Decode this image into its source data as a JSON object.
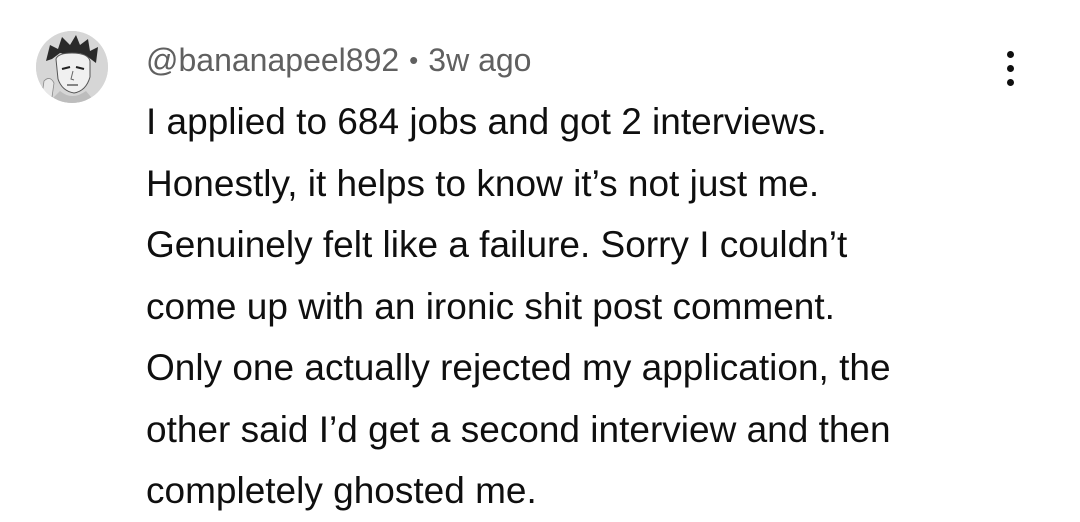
{
  "comment": {
    "author": "@bananapeel892",
    "separator": "•",
    "timestamp": "3w ago",
    "avatar_icon": "manga-portrait-avatar",
    "menu_icon": "more-vertical-icon",
    "lines": [
      "I applied to 684 jobs and got 2 interviews.",
      "Honestly, it helps to know it’s not just me.",
      "Genuinely felt like a failure. Sorry I couldn’t",
      "come up with an ironic shit post comment.",
      "Only one actually rejected my application, the",
      "other said I’d get a second interview and then",
      "completely ghosted me."
    ]
  },
  "colors": {
    "text": "#0f0f0f",
    "meta": "#606060",
    "background": "#ffffff"
  }
}
